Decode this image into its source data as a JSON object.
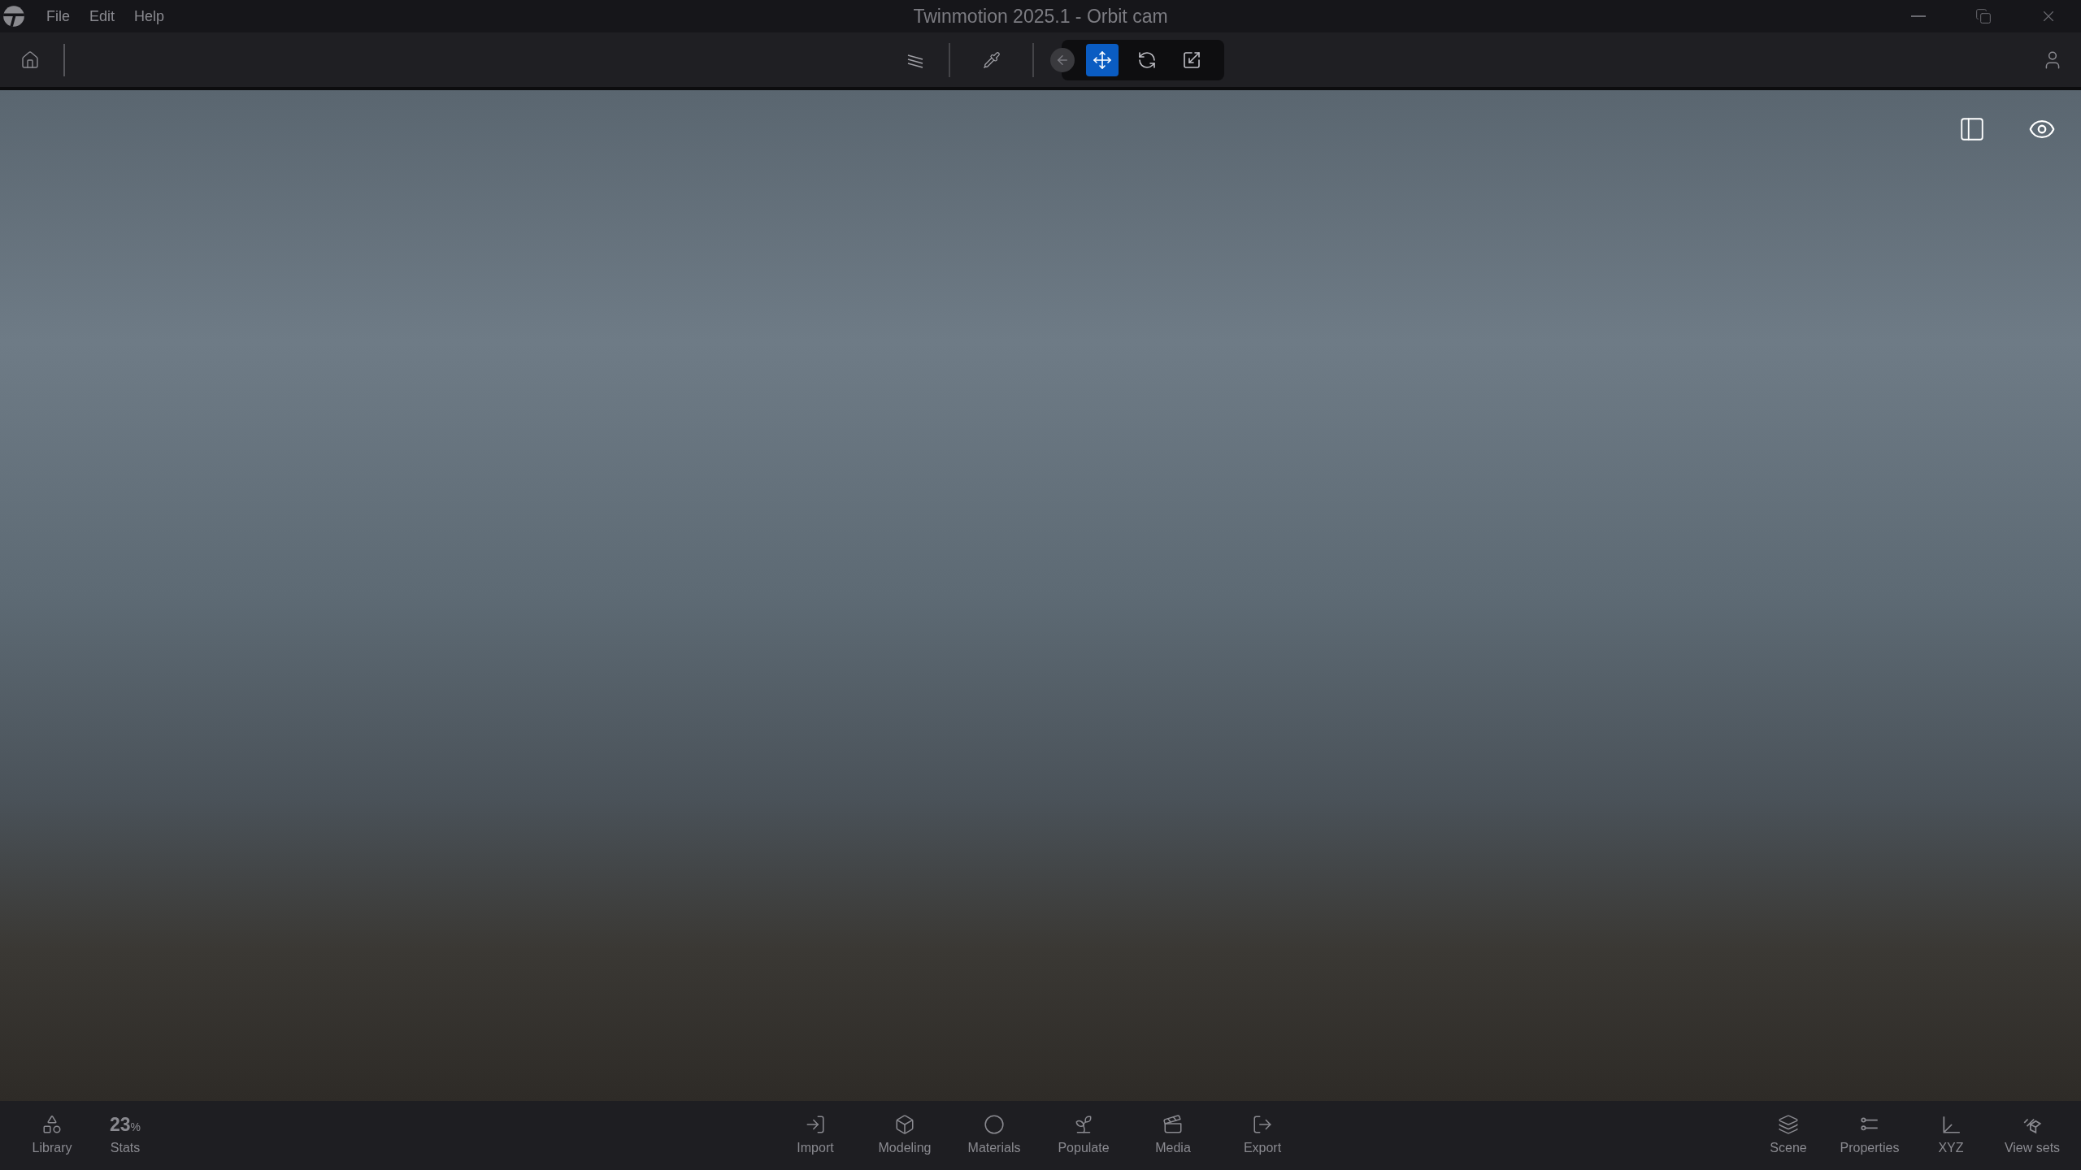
{
  "menu": [
    "File",
    "Edit",
    "Help"
  ],
  "window": {
    "title": "Twinmotion 2025.1 - Orbit cam"
  },
  "tools": [
    {
      "selected": true
    },
    {
      "selected": false
    },
    {
      "selected": false
    }
  ],
  "stats": {
    "value": "23",
    "unit": "%",
    "label": "Stats"
  },
  "left_items": [
    "Library"
  ],
  "center_items": [
    "Import",
    "Modeling",
    "Materials",
    "Populate",
    "Media",
    "Export"
  ],
  "right_items": [
    "Scene",
    "Properties",
    "XYZ",
    "View sets"
  ]
}
